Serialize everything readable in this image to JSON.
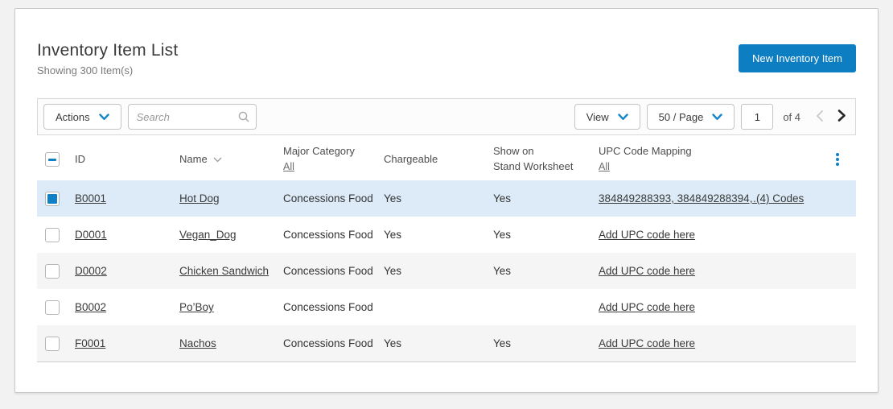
{
  "page": {
    "title": "Inventory Item List",
    "subtitle": "Showing 300 Item(s)",
    "new_item_button": "New Inventory Item"
  },
  "toolbar": {
    "actions_label": "Actions",
    "search_placeholder": "Search",
    "view_label": "View",
    "page_size_label": "50 / Page",
    "page_number": "1",
    "page_total_label": "of 4"
  },
  "table": {
    "header": {
      "id": "ID",
      "name": "Name",
      "major_category": "Major Category",
      "major_category_filter": "All",
      "chargeable": "Chargeable",
      "show_on_line1": "Show on",
      "show_on_line2": "Stand Worksheet",
      "upc": "UPC Code Mapping",
      "upc_filter": "All"
    },
    "rows": [
      {
        "id": "B0001",
        "name": "Hot Dog",
        "category": "Concessions Food",
        "chargeable": "Yes",
        "show_on_stand": "Yes",
        "upc_codes": "384849288393, 384849288394,…",
        "codes_link": "(4) Codes"
      },
      {
        "id": "D0001",
        "name": "Vegan_Dog",
        "category": "Concessions Food",
        "chargeable": "Yes",
        "show_on_stand": "Yes",
        "upc_link": "Add UPC code here"
      },
      {
        "id": "D0002",
        "name": "Chicken Sandwich",
        "category": "Concessions Food",
        "chargeable": "Yes",
        "show_on_stand": "Yes",
        "upc_link": "Add UPC code here"
      },
      {
        "id": "B0002",
        "name": "Po’Boy",
        "category": "Concessions Food",
        "chargeable": "",
        "show_on_stand": "",
        "upc_link": "Add UPC code here"
      },
      {
        "id": "F0001",
        "name": "Nachos",
        "category": "Concessions Food",
        "chargeable": "Yes",
        "show_on_stand": "Yes",
        "upc_link": "Add UPC code here"
      }
    ]
  },
  "colors": {
    "accent_blue": "#0d7ec2",
    "icon_blue": "#1080c4",
    "selected_row": "#dcebf7",
    "alt_row": "#f5f5f5"
  },
  "icons": {
    "chevron_down": "⌄",
    "search": "⌕",
    "kebab": "⋮",
    "chevron_left": "‹",
    "chevron_right": "›",
    "sort_indicator": "∨"
  }
}
